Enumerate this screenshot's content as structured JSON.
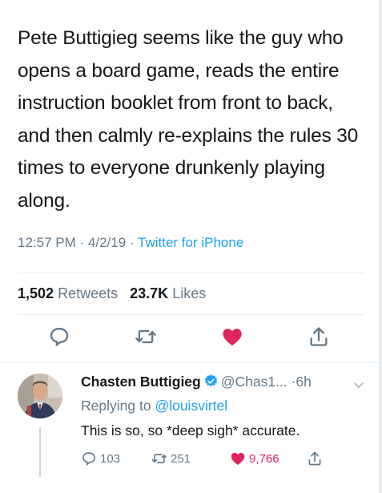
{
  "tweet": {
    "text": "Pete Buttigieg seems like the guy who opens a board game, reads the entire instruction booklet from front to back, and then calmly re-explains the rules 30 times to everyone drunkenly playing along.",
    "time": "12:57 PM",
    "date": "4/2/19",
    "separator": "·",
    "source": "Twitter for iPhone"
  },
  "stats": {
    "retweets_count": "1,502",
    "retweets_label": "Retweets",
    "likes_count": "23.7K",
    "likes_label": "Likes"
  },
  "actions": {
    "icons": [
      "reply-icon",
      "retweet-icon",
      "like-icon",
      "share-icon"
    ],
    "like_color": "#e0245e"
  },
  "reply": {
    "name": "Chasten Buttigieg",
    "handle": "@Chas1...",
    "time": "6h",
    "separator": "·",
    "replying_prefix": "Replying to",
    "replying_to": "@louisvirtel",
    "text": "This is so, so *deep sigh* accurate.",
    "reply_count": "103",
    "retweet_count": "251",
    "like_count": "9,766"
  },
  "colors": {
    "accent": "#1da1f2",
    "muted": "#657786",
    "text": "#14171a",
    "like": "#e0245e"
  }
}
